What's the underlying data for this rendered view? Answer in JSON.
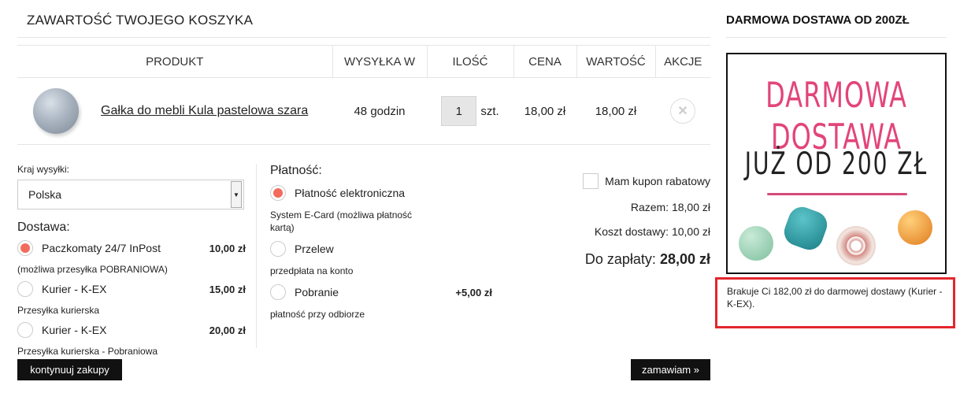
{
  "cart": {
    "title": "ZAWARTOŚĆ TWOJEGO KOSZYKA",
    "columns": [
      "PRODUKT",
      "WYSYŁKA W",
      "ILOŚĆ",
      "CENA",
      "WARTOŚĆ",
      "AKCJE"
    ],
    "item": {
      "name": "Gałka do mebli Kula pastelowa szara",
      "shipping": "48 godzin",
      "quantity": "1",
      "unit": "szt.",
      "price": "18,00 zł",
      "value": "18,00 zł"
    }
  },
  "shipping": {
    "country_label": "Kraj wysyłki:",
    "country_value": "Polska",
    "delivery_label": "Dostawa:",
    "options": [
      {
        "name": "Paczkomaty 24/7 InPost",
        "price": "10,00 zł",
        "desc": "(możliwa przesyłka POBRANIOWA)",
        "selected": true
      },
      {
        "name": "Kurier - K-EX",
        "price": "15,00 zł",
        "desc": "Przesyłka kurierska",
        "selected": false
      },
      {
        "name": "Kurier - K-EX",
        "price": "20,00 zł",
        "desc": "Przesyłka kurierska - Pobraniowa",
        "selected": false
      }
    ]
  },
  "payment": {
    "label": "Płatność:",
    "options": [
      {
        "name": "Płatność elektroniczna",
        "price": "",
        "desc": "System E-Card (możliwa płatność kartą)",
        "selected": true
      },
      {
        "name": "Przelew",
        "price": "",
        "desc": "przedpłata na konto",
        "selected": false
      },
      {
        "name": "Pobranie",
        "price": "+5,00 zł",
        "desc": "płatność przy odbiorze",
        "selected": false
      }
    ]
  },
  "summary": {
    "coupon_label": "Mam kupon rabatowy",
    "subtotal": "Razem: 18,00 zł",
    "shipping_cost": "Koszt dostawy: 10,00 zł",
    "total_label": "Do zapłaty:",
    "total_value": "28,00 zł"
  },
  "buttons": {
    "continue": "kontynuuj zakupy",
    "order": "zamawiam »"
  },
  "sidebar": {
    "title": "DARMOWA DOSTAWA OD 200ZŁ",
    "promo_line1": "DARMOWA DOSTAWA",
    "promo_line2": "JUŻ OD 200 ZŁ",
    "info": "Brakuje Ci 182,00 zł do darmowej dostawy (Kurier - K-EX)."
  },
  "colors": {
    "radio_selected": "#f36b5c",
    "highlight_border": "#e3262c",
    "promo_pink": "#e2457a"
  }
}
